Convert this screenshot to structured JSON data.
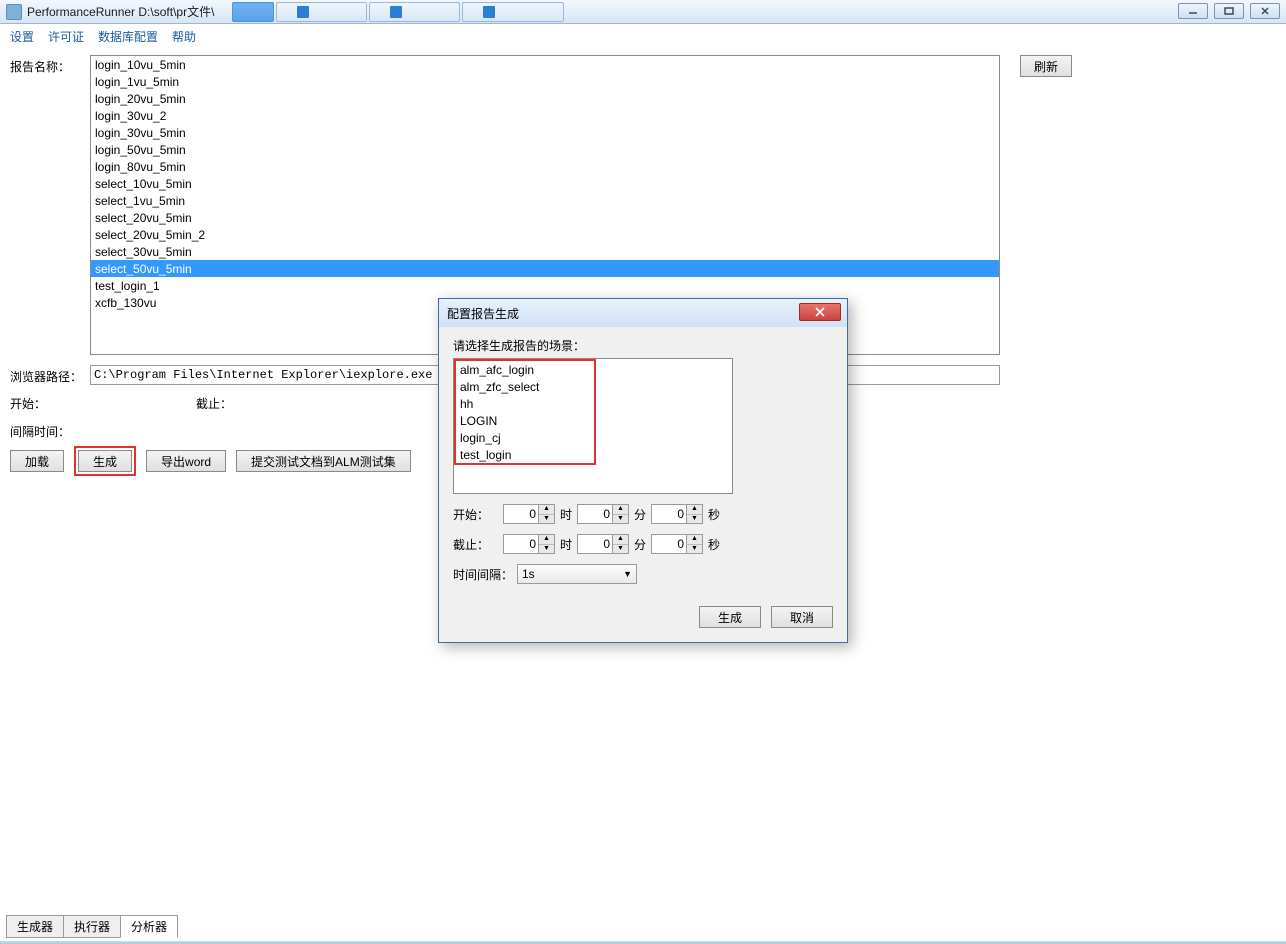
{
  "titlebar": {
    "title": "PerformanceRunner  D:\\soft\\pr文件\\"
  },
  "menu": {
    "settings": "设置",
    "license": "许可证",
    "dbconfig": "数据库配置",
    "help": "帮助"
  },
  "main": {
    "report_name_label": "报告名称：",
    "refresh": "刷新",
    "reports": [
      "login_10vu_5min",
      "login_1vu_5min",
      "login_20vu_5min",
      "login_30vu_2",
      "login_30vu_5min",
      "login_50vu_5min",
      "login_80vu_5min",
      "select_10vu_5min",
      "select_1vu_5min",
      "select_20vu_5min",
      "select_20vu_5min_2",
      "select_30vu_5min",
      "select_50vu_5min",
      "test_login_1",
      "xcfb_130vu"
    ],
    "selected_index": 12,
    "browser_label": "浏览器路径：",
    "browser_path": "C:\\Program Files\\Internet Explorer\\iexplore.exe",
    "start_label": "开始：",
    "end_label": "截止：",
    "interval_label": "间隔时间：",
    "btn_load": "加载",
    "btn_generate": "生成",
    "btn_export_word": "导出word",
    "btn_submit": "提交测试文档到ALM测试集"
  },
  "tabs": {
    "generator": "生成器",
    "executor": "执行器",
    "analyzer": "分析器"
  },
  "modal": {
    "title": "配置报告生成",
    "prompt": "请选择生成报告的场景：",
    "scenes": [
      "alm_afc_login",
      "alm_zfc_select",
      "hh",
      "LOGIN",
      "login_cj",
      "test_login"
    ],
    "start_label": "开始：",
    "end_label": "截止：",
    "hour": "时",
    "minute": "分",
    "second": "秒",
    "start_h": "0",
    "start_m": "0",
    "start_s": "0",
    "end_h": "0",
    "end_m": "0",
    "end_s": "0",
    "interval_label": "时间间隔：",
    "interval_value": "1s",
    "btn_generate": "生成",
    "btn_cancel": "取消"
  }
}
